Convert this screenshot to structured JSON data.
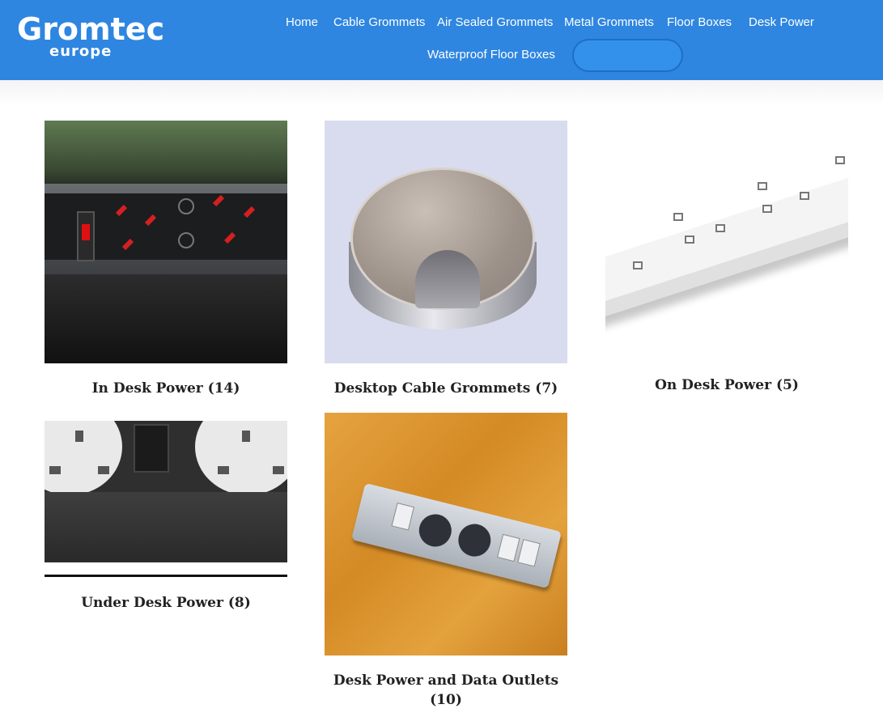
{
  "brand": {
    "logo_main": "Gromtec",
    "logo_sub": "europe"
  },
  "nav": {
    "items": [
      {
        "label": "Home"
      },
      {
        "label": "Cable Grommets"
      },
      {
        "label": "Air Sealed Grommets"
      },
      {
        "label": "Metal Grommets"
      },
      {
        "label": "Floor Boxes"
      },
      {
        "label": "Desk Power"
      },
      {
        "label": "Waterproof Floor Boxes"
      }
    ]
  },
  "colors": {
    "header_bg": "#2e86e0",
    "nav_text": "#ffffff",
    "title_text": "#222222"
  },
  "categories": [
    {
      "name": "In Desk Power",
      "count": "(14)"
    },
    {
      "name": "Desktop Cable Grommets",
      "count": "(7)"
    },
    {
      "name": "On Desk Power",
      "count": "(5)"
    },
    {
      "name": "Under Desk Power",
      "count": "(8)"
    },
    {
      "name": "Desk Power and Data Outlets",
      "count": "(10)"
    }
  ]
}
